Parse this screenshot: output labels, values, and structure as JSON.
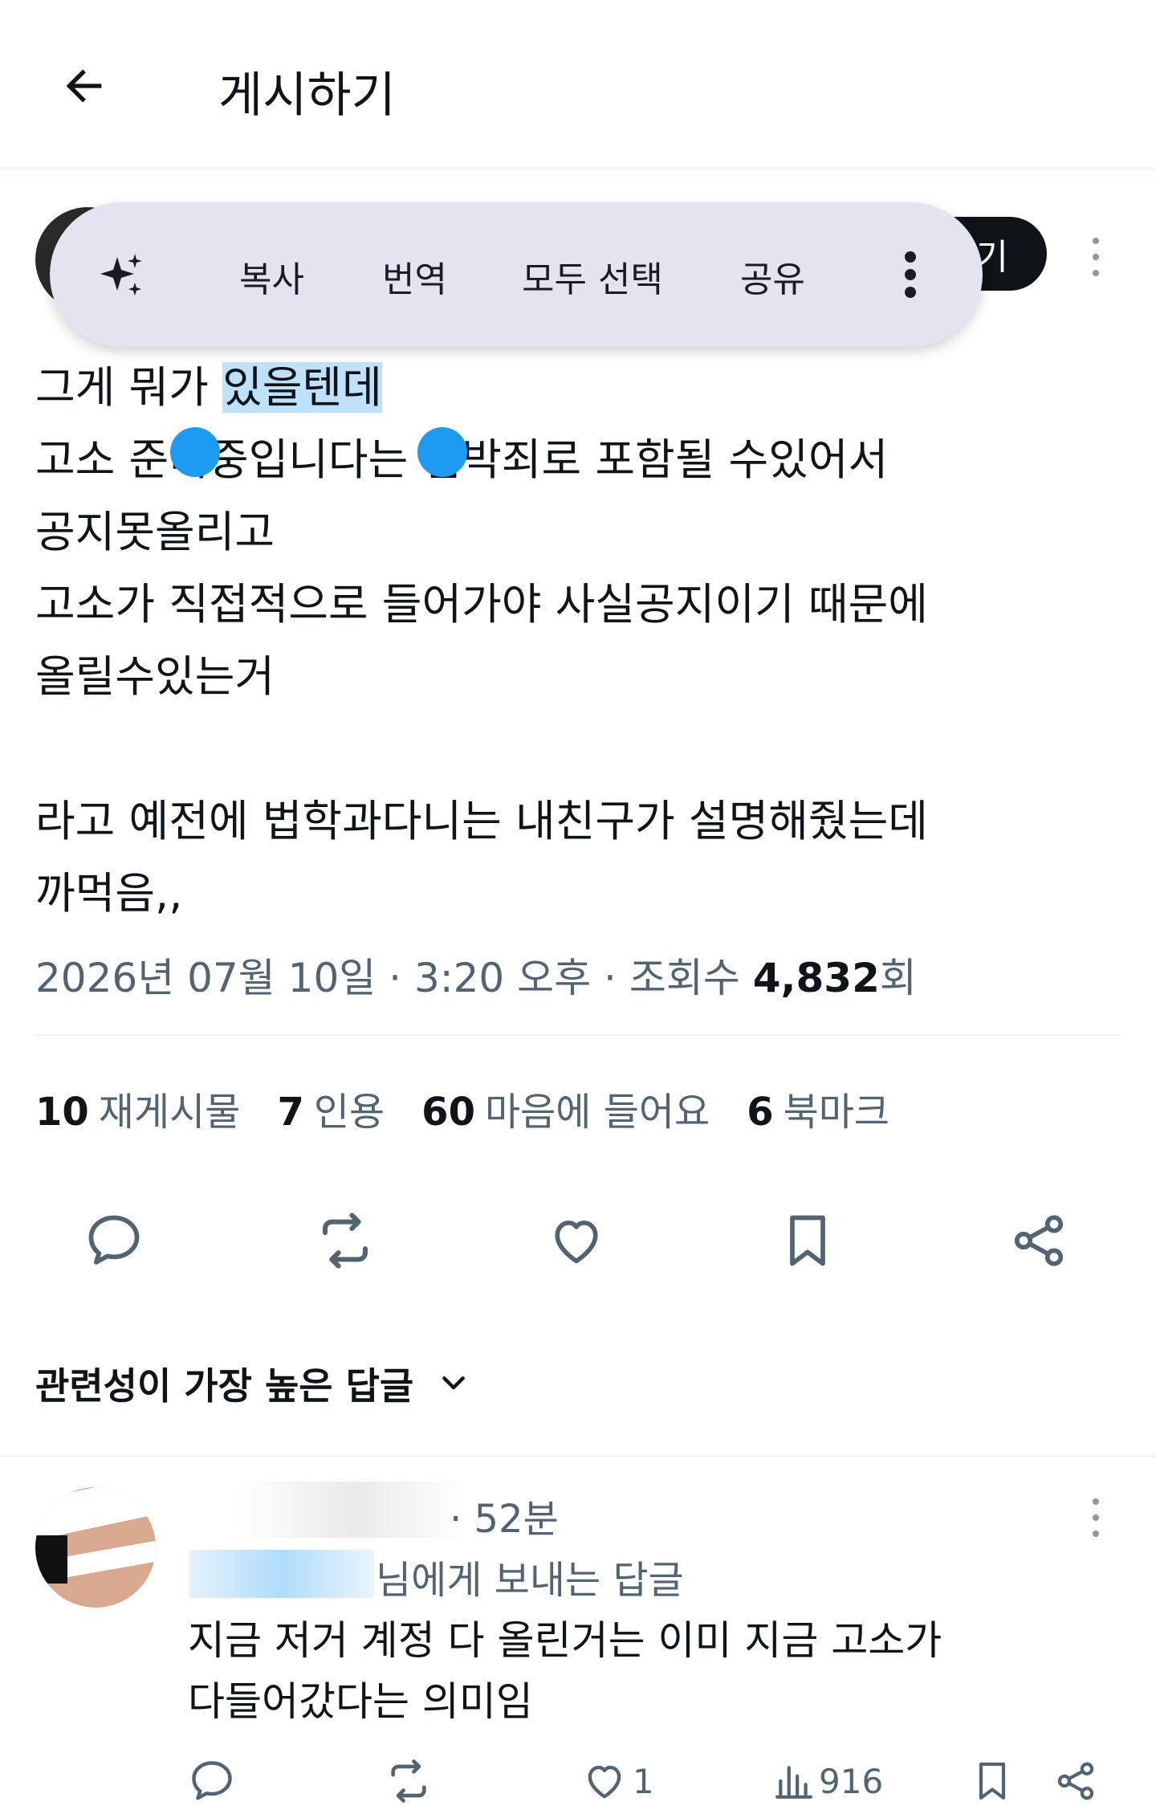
{
  "header": {
    "title": "게시하기"
  },
  "author": {
    "follow_label": "기"
  },
  "selection_toolbar": {
    "items": [
      "복사",
      "번역",
      "모두 선택",
      "공유"
    ]
  },
  "tweet": {
    "lines": [
      {
        "before": "그게 뭐가 ",
        "selected": "있을텐데",
        "after": ""
      },
      {
        "before": "고소 준비중입니다는 협박죄로 포함될 수있어서",
        "selected": "",
        "after": ""
      },
      {
        "before": "공지못올리고",
        "selected": "",
        "after": ""
      },
      {
        "before": "고소가 직접적으로 들어가야 사실공지이기 때문에",
        "selected": "",
        "after": ""
      },
      {
        "before": "올릴수있는거",
        "selected": "",
        "after": ""
      },
      {
        "before": "",
        "selected": "",
        "after": ""
      },
      {
        "before": "라고 예전에 법학과다니는 내친구가 설명해줬는데",
        "selected": "",
        "after": ""
      },
      {
        "before": "까먹음,,",
        "selected": "",
        "after": ""
      }
    ],
    "meta_prefix": "2026년 07월 10일 · 3:20 오후 · 조회수 ",
    "views": "4,832",
    "views_suffix": "회"
  },
  "stats": [
    {
      "count": "10",
      "label": "재게시물"
    },
    {
      "count": "7",
      "label": "인용"
    },
    {
      "count": "60",
      "label": "마음에 들어요"
    },
    {
      "count": "6",
      "label": "북마크"
    }
  ],
  "sort": {
    "label": "관련성이 가장 높은 답글"
  },
  "reply": {
    "time": "· 52분",
    "reply_to_suffix": "님에게 보내는 답글",
    "text_lines": [
      "지금 저거 계정 다 올린거는 이미 지금 고소가",
      "다들어갔다는 의미임"
    ],
    "likes": "1",
    "views": "916"
  },
  "colors": {
    "accent": "#1d9bf0",
    "text": "#0f1419",
    "secondary": "#536471",
    "selection": "#bfe1fb",
    "toolbar_bg": "#e4e3ef"
  }
}
